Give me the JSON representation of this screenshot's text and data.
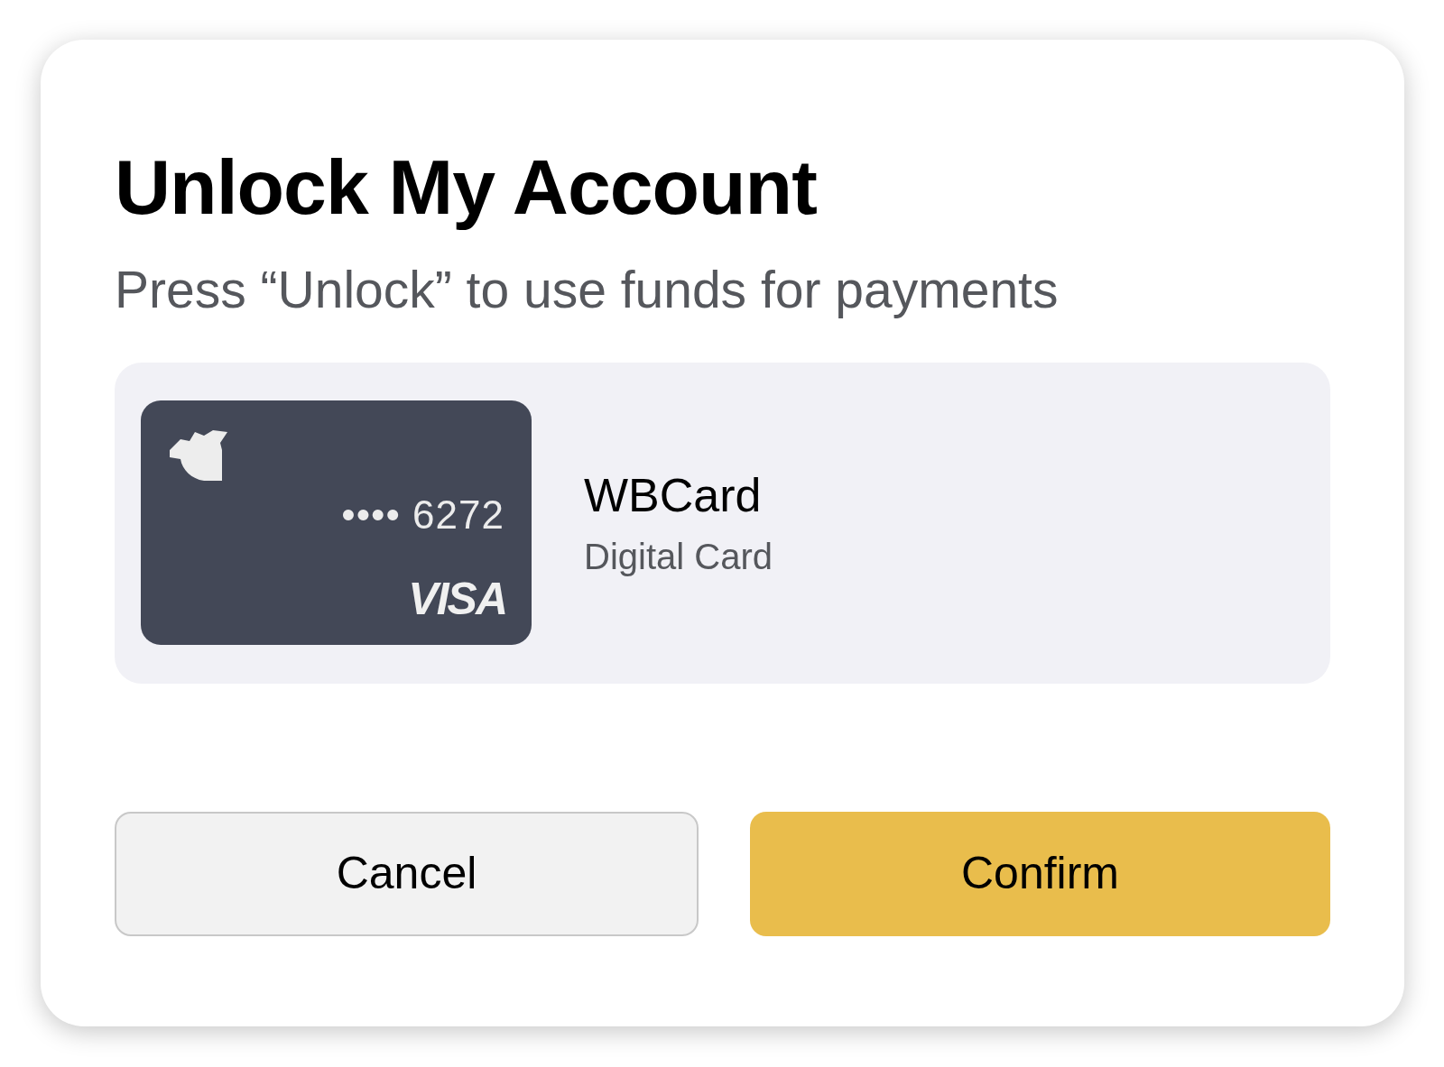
{
  "dialog": {
    "title": "Unlock My Account",
    "subtitle": "Press “Unlock” to use funds for payments",
    "card": {
      "masked_number": "•••• 6272",
      "network": "VISA",
      "name": "WBCard",
      "type": "Digital Card"
    },
    "buttons": [
      {
        "label": "Cancel",
        "kind": "secondary"
      },
      {
        "label": "Confirm",
        "kind": "primary"
      }
    ]
  }
}
